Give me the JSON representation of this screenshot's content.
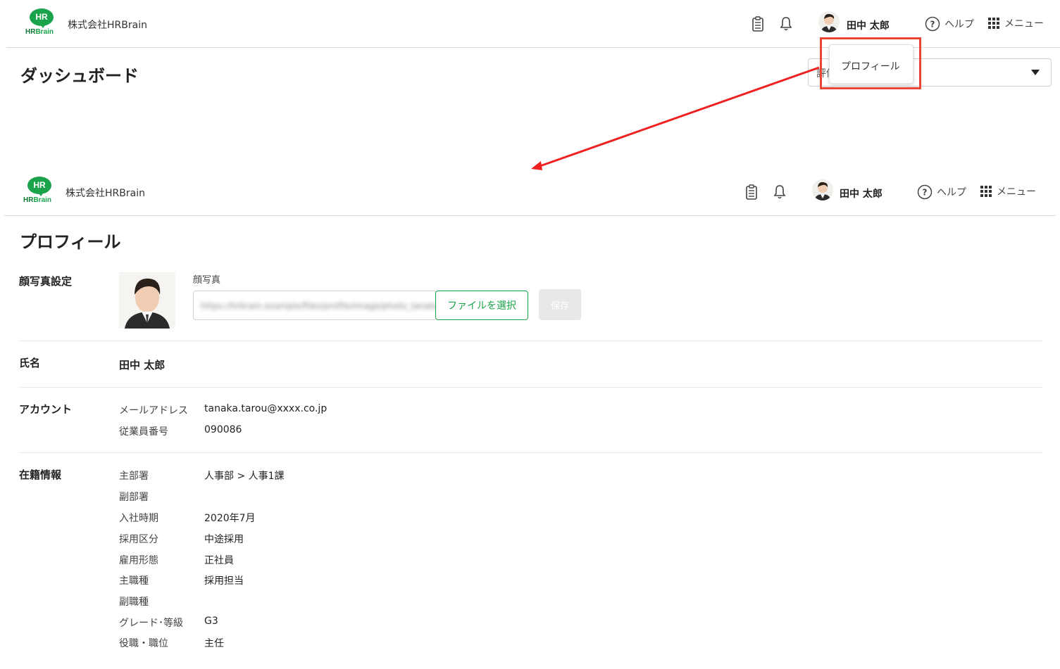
{
  "colors": {
    "brand": "#1aa34a",
    "annotation": "#ee4433"
  },
  "header": {
    "logo_badge": "HR",
    "logo_word_hr": "HR",
    "logo_word_brain": "Brain",
    "company": "株式会社HRBrain",
    "user_name": "田中 太郎",
    "help_label": "ヘルプ",
    "menu_label": "メニュー"
  },
  "dashboard": {
    "title": "ダッシュボード",
    "select_partial": "評価",
    "dropdown_item": "プロフィール"
  },
  "profile": {
    "title": "プロフィール",
    "photo_section": "顔写真設定",
    "photo_field_label": "顔写真",
    "file_value": "https://hrbrain.example/files/profile/image/photo_tanaka.jpg",
    "file_button": "ファイルを選択",
    "save_button": "保存",
    "name_section": "氏名",
    "name_value": "田中 太郎",
    "account_section": "アカウント",
    "account_fields": [
      {
        "label": "メールアドレス",
        "value": "tanaka.tarou@xxxx.co.jp"
      },
      {
        "label": "従業員番号",
        "value": "090086"
      }
    ],
    "employment_section": "在籍情報",
    "employment_fields": [
      {
        "label": "主部署",
        "value": "人事部 > 人事1課"
      },
      {
        "label": "副部署",
        "value": ""
      },
      {
        "label": "入社時期",
        "value": "2020年7月"
      },
      {
        "label": "採用区分",
        "value": "中途採用"
      },
      {
        "label": "雇用形態",
        "value": "正社員"
      },
      {
        "label": "主職種",
        "value": "採用担当"
      },
      {
        "label": "副職種",
        "value": ""
      },
      {
        "label": "グレード･等級",
        "value": "G3"
      },
      {
        "label": "役職・職位",
        "value": "主任"
      }
    ]
  }
}
